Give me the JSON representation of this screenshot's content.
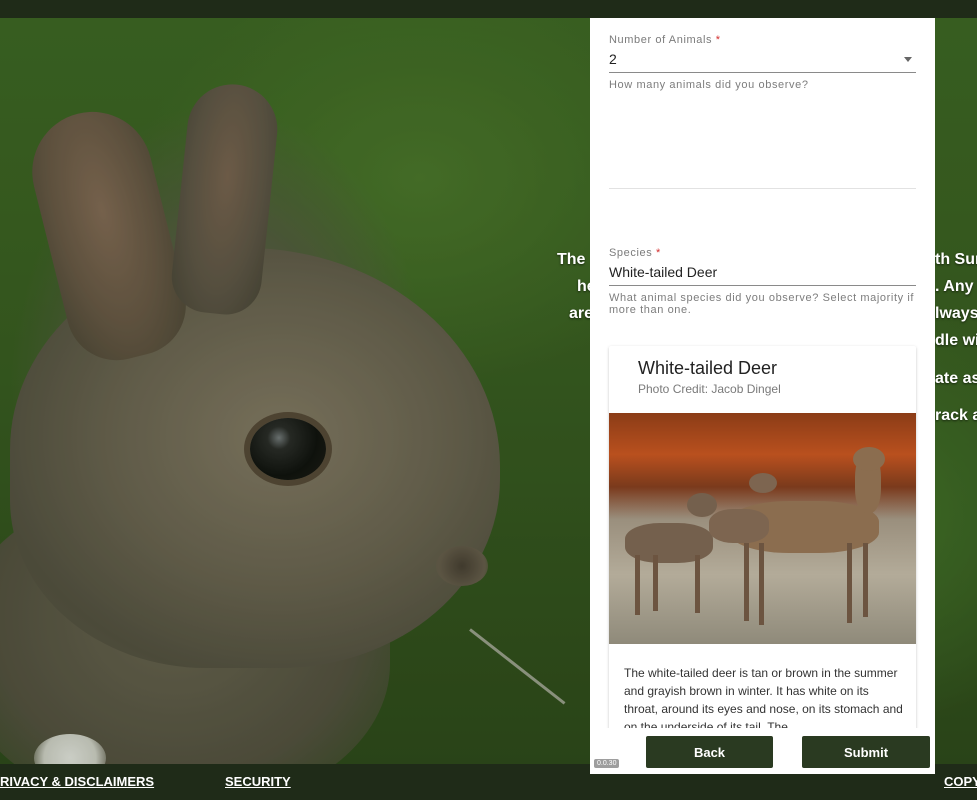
{
  "background": {
    "lines": [
      "The",
      "he",
      "are",
      "th Surv",
      ". Any",
      "lways",
      "dle wi",
      "ate ass",
      "rack an"
    ]
  },
  "footer": {
    "links": [
      "RIVACY & DISCLAIMERS",
      "SECURITY",
      "COPY"
    ]
  },
  "form": {
    "animals_field": {
      "label": "Number of Animals",
      "required_mark": "*",
      "value": "2",
      "help": "How many animals did you observe?"
    },
    "species_field": {
      "label": "Species",
      "required_mark": "*",
      "value": "White-tailed Deer",
      "help": "What animal species did you observe? Select majority if more than one."
    },
    "species_card": {
      "title": "White-tailed Deer",
      "photo_credit": "Photo Credit: Jacob Dingel",
      "description": "The white-tailed deer is tan or brown in the summer and grayish brown in winter. It has white on its throat, around its eyes and nose, on its stomach and on the underside of its tail. The"
    }
  },
  "actions": {
    "version": "0.0.30",
    "back_label": "Back",
    "submit_label": "Submit"
  },
  "colors": {
    "primary_button": "#2a3a21",
    "required": "#d32f2f",
    "footer_bg": "#1f2b18"
  }
}
